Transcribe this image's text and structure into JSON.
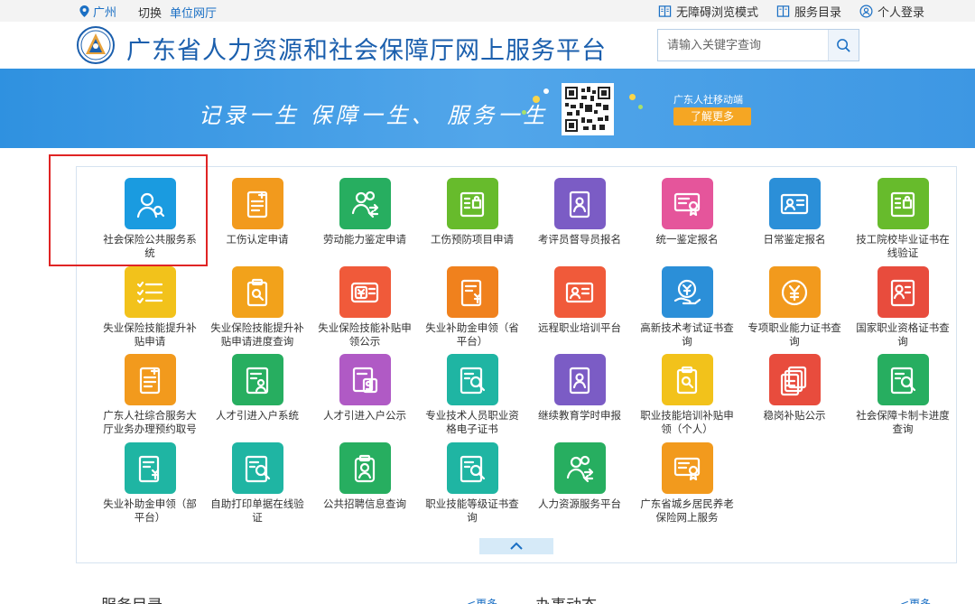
{
  "topbar": {
    "city": "广州",
    "switch_label": "切换",
    "department": "单位网厅",
    "accessibility": "无障碍浏览模式",
    "service_catalog": "服务目录",
    "login": "个人登录"
  },
  "header": {
    "title": "广东省人力资源和社会保障厅网上服务平台",
    "search_placeholder": "请输入关键字查询"
  },
  "banner": {
    "slogan": "记录一生  保障一生、 服务一生",
    "mobile_label": "广东人社移动端",
    "more_label": "了解更多"
  },
  "colors": {
    "brand_blue": "#1b5fad",
    "banner_blue": "#3d97e3",
    "highlight_red": "#e02424"
  },
  "services": [
    {
      "label": "社会保险公共服务系统",
      "color": "#1a9be0",
      "icon": "user-search-icon"
    },
    {
      "label": "工伤认定申请",
      "color": "#f29a1d",
      "icon": "document-plus-icon"
    },
    {
      "label": "劳动能力鉴定申请",
      "color": "#27ae60",
      "icon": "users-transfer-icon"
    },
    {
      "label": "工伤预防项目申请",
      "color": "#67bb2c",
      "icon": "document-lock-icon"
    },
    {
      "label": "考评员督导员报名",
      "color": "#7b5cc5",
      "icon": "id-document-icon"
    },
    {
      "label": "统一鉴定报名",
      "color": "#e5559b",
      "icon": "certificate-icon"
    },
    {
      "label": "日常鉴定报名",
      "color": "#2b8fd8",
      "icon": "id-card-icon"
    },
    {
      "label": "技工院校毕业证书在线验证",
      "color": "#67bb2c",
      "icon": "document-lock-icon"
    },
    {
      "label": "失业保险技能提升补贴申请",
      "color": "#f2c21b",
      "icon": "checklist-icon"
    },
    {
      "label": "失业保险技能提升补贴申请进度查询",
      "color": "#f2a21b",
      "icon": "clipboard-search-icon"
    },
    {
      "label": "失业保险技能补贴申领公示",
      "color": "#f05a3a",
      "icon": "money-card-icon"
    },
    {
      "label": "失业补助金申领（省平台）",
      "color": "#f0811d",
      "icon": "document-yuan-icon"
    },
    {
      "label": "远程职业培训平台",
      "color": "#f05a3a",
      "icon": "id-card-icon"
    },
    {
      "label": "高新技术考试证书查询",
      "color": "#2b8fd8",
      "icon": "yuan-hand-icon"
    },
    {
      "label": "专项职业能力证书查询",
      "color": "#f29a1d",
      "icon": "yuan-circle-icon"
    },
    {
      "label": "国家职业资格证书查询",
      "color": "#e84c3d",
      "icon": "person-document-icon"
    },
    {
      "label": "广东人社综合服务大厅业务办理预约取号",
      "color": "#f29a1d",
      "icon": "document-plus-icon"
    },
    {
      "label": "人才引进入户系统",
      "color": "#27ae60",
      "icon": "document-user-icon"
    },
    {
      "label": "人才引进入户公示",
      "color": "#b05ac5",
      "icon": "document-dollar-icon"
    },
    {
      "label": "专业技术人员职业资格电子证书",
      "color": "#1fb5a3",
      "icon": "document-search-icon"
    },
    {
      "label": "继续教育学时申报",
      "color": "#7b5cc5",
      "icon": "id-document-icon"
    },
    {
      "label": "职业技能培训补贴申领（个人）",
      "color": "#f2c21b",
      "icon": "clipboard-search-icon"
    },
    {
      "label": "稳岗补贴公示",
      "color": "#e84c3d",
      "icon": "stack-documents-icon"
    },
    {
      "label": "社会保障卡制卡进度查询",
      "color": "#27ae60",
      "icon": "document-search-icon"
    },
    {
      "label": "失业补助金申领（部平台）",
      "color": "#1fb5a3",
      "icon": "document-yuan-icon"
    },
    {
      "label": "自助打印单据在线验证",
      "color": "#1fb5a3",
      "icon": "document-search-icon"
    },
    {
      "label": "公共招聘信息查询",
      "color": "#27ae60",
      "icon": "person-clipboard-icon"
    },
    {
      "label": "职业技能等级证书查询",
      "color": "#1fb5a3",
      "icon": "document-search-icon"
    },
    {
      "label": "人力资源服务平台",
      "color": "#27ae60",
      "icon": "users-transfer-icon"
    },
    {
      "label": "广东省城乡居民养老保险网上服务",
      "color": "#f29a1d",
      "icon": "certificate-icon"
    }
  ],
  "bottom": {
    "left_title": "服务目录",
    "left_more": "<更多",
    "right_title": "办事动态",
    "right_more": "<更多"
  }
}
